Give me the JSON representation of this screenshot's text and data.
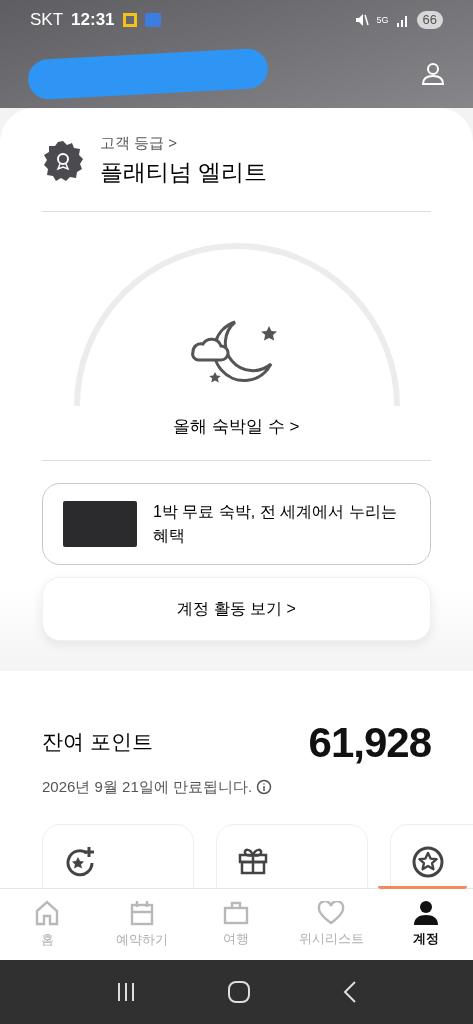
{
  "status_bar": {
    "carrier": "SKT",
    "time": "12:31",
    "network": "5G",
    "battery": "66"
  },
  "tier": {
    "label": "고객 등급 >",
    "name": "플래티넘 엘리트"
  },
  "nights": {
    "label": "올해 숙박일 수 >"
  },
  "card_promo": {
    "text": "1박 무료 숙박, 전 세계에서 누리는 혜택"
  },
  "activity_button": {
    "label": "계정 활동 보기 >"
  },
  "points": {
    "label": "잔여 포인트",
    "value": "61,928",
    "expiry": "2026년 9월 21일에 만료됩니다."
  },
  "tiles": [
    {
      "kind": "star-plus"
    },
    {
      "kind": "gift"
    },
    {
      "kind": "star-circle"
    }
  ],
  "tabs": [
    {
      "kind": "home",
      "label": "홈",
      "selected": false
    },
    {
      "kind": "calendar",
      "label": "예약하기",
      "selected": false
    },
    {
      "kind": "suitcase",
      "label": "여행",
      "selected": false
    },
    {
      "kind": "heart",
      "label": "위시리스트",
      "selected": false
    },
    {
      "kind": "person",
      "label": "계정",
      "selected": true
    }
  ]
}
